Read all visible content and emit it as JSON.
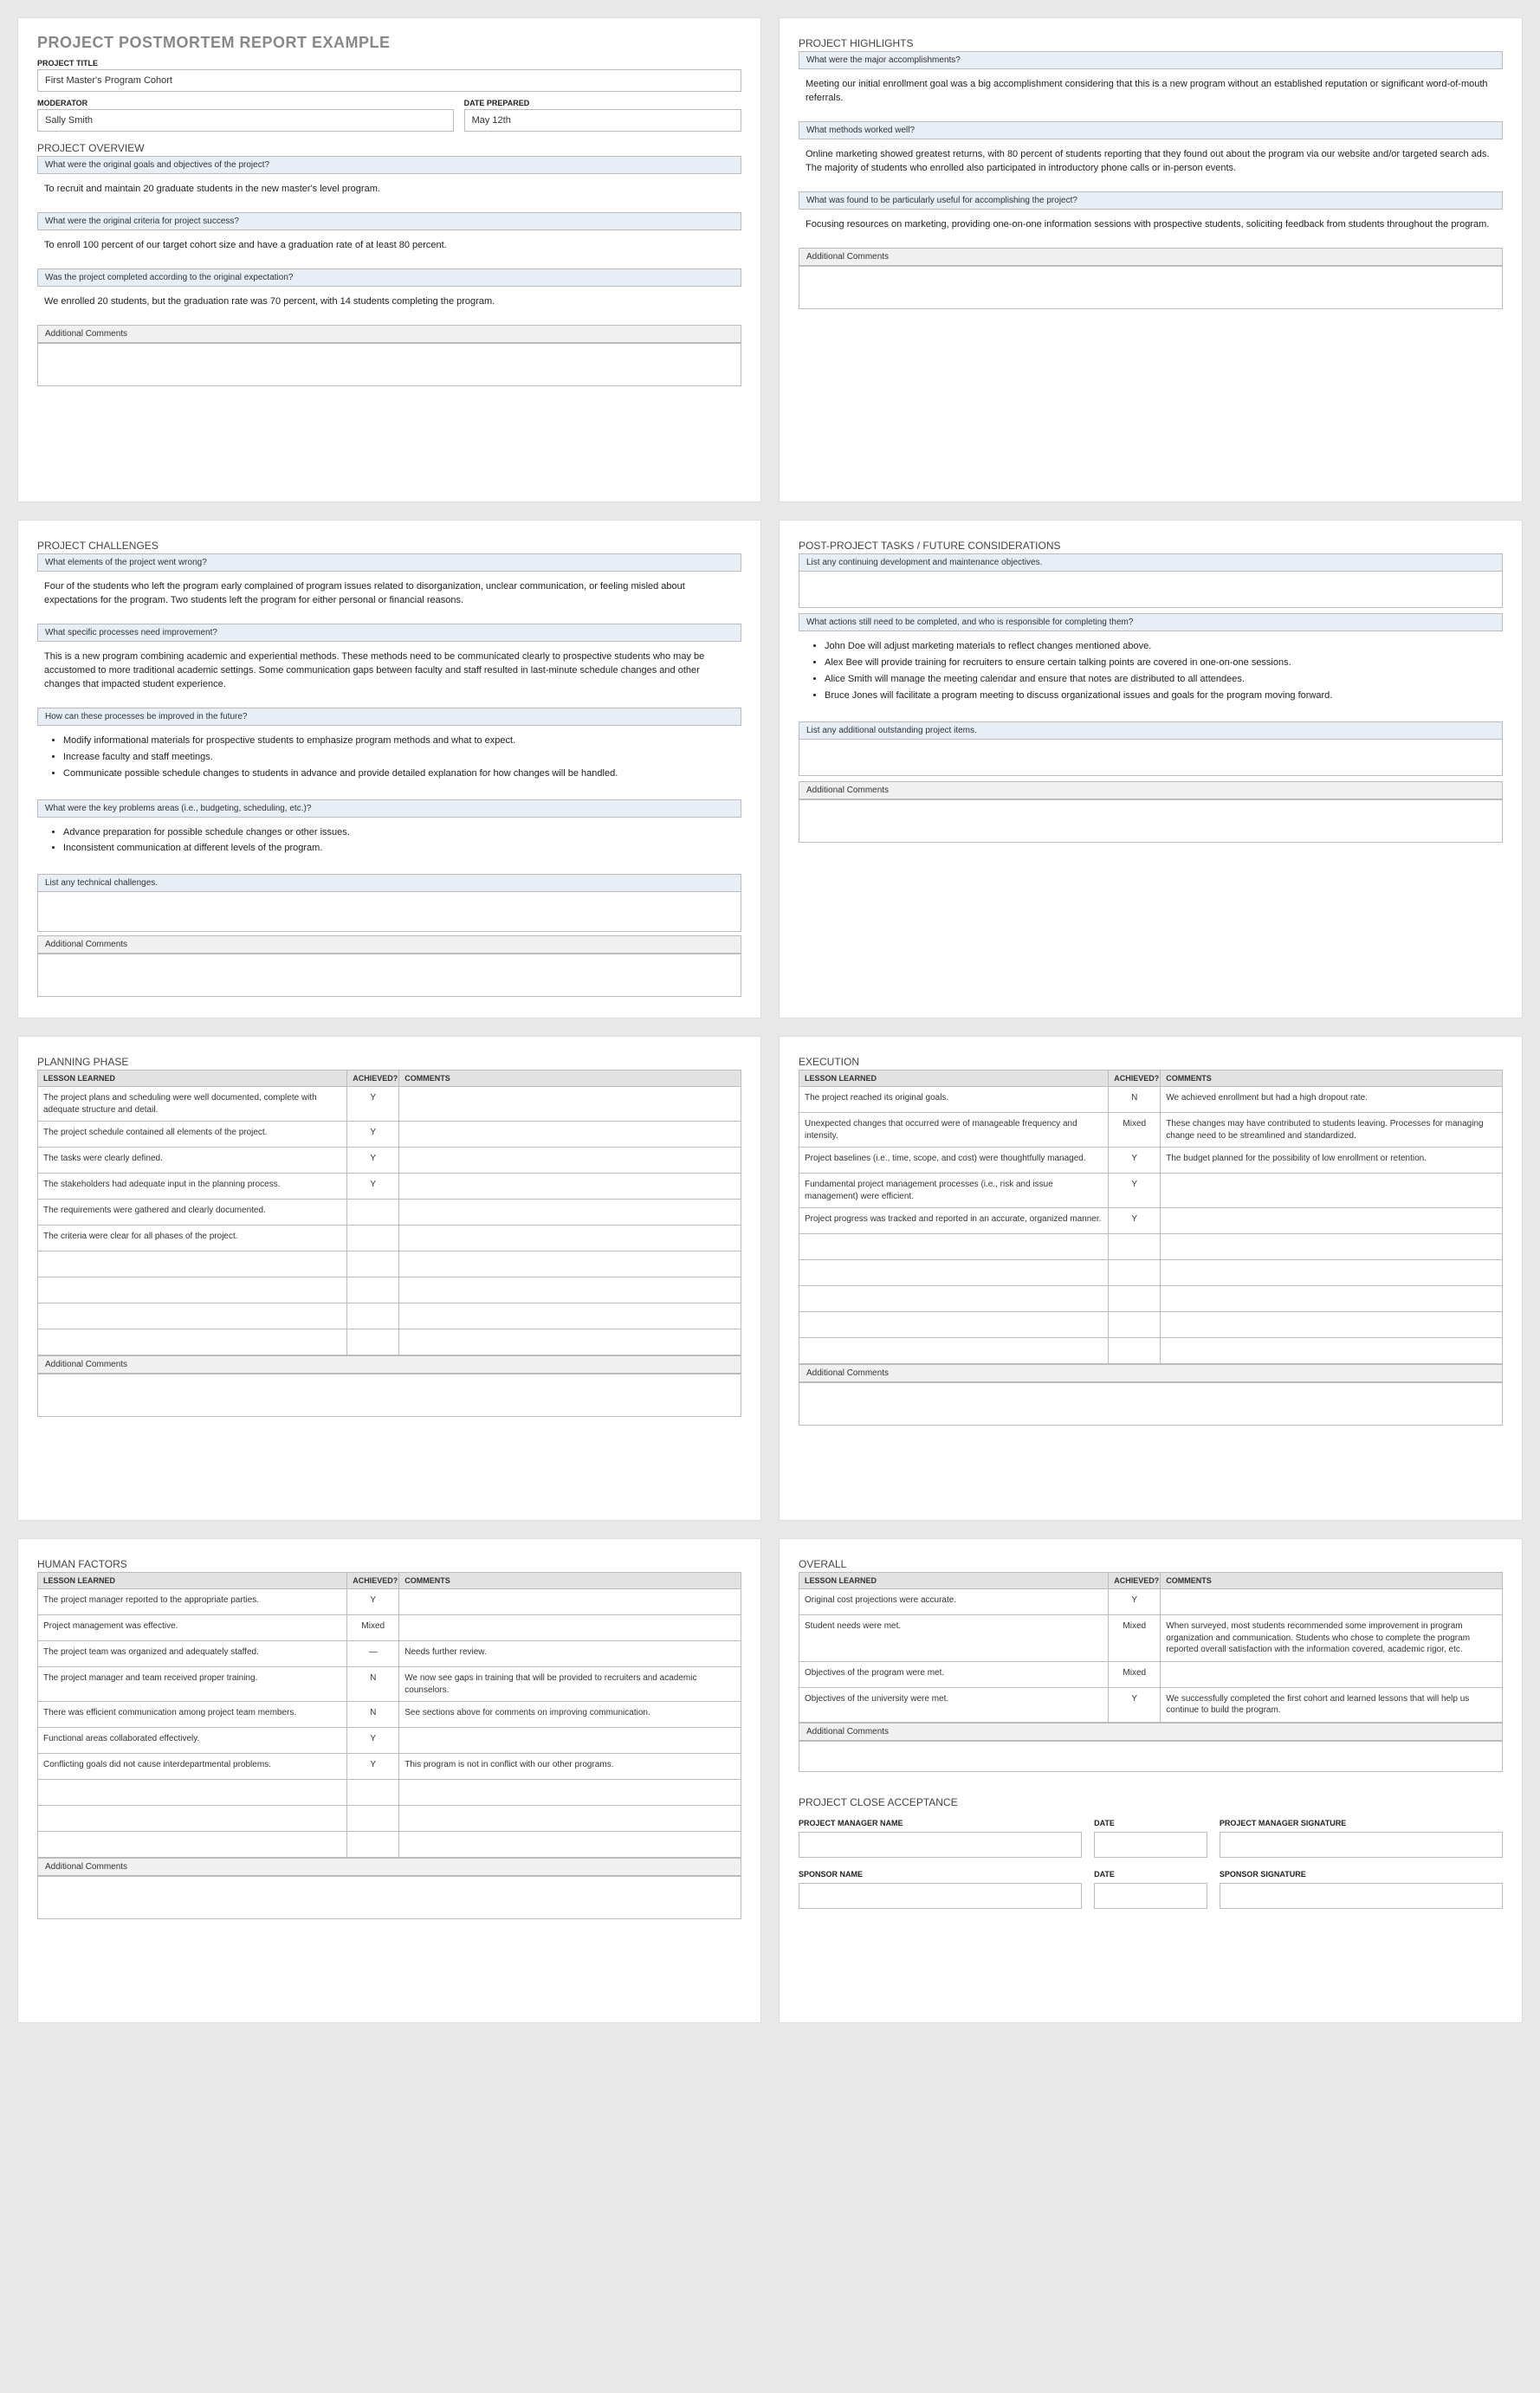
{
  "docTitle": "PROJECT POSTMORTEM REPORT EXAMPLE",
  "labels": {
    "projectTitle": "PROJECT TITLE",
    "moderator": "MODERATOR",
    "datePrepared": "DATE PREPARED",
    "additionalComments": "Additional Comments",
    "lessonLearned": "LESSON LEARNED",
    "achieved": "ACHIEVED?",
    "comments": "COMMENTS"
  },
  "header": {
    "projectTitle": "First Master's Program Cohort",
    "moderator": "Sally Smith",
    "datePrepared": "May 12th"
  },
  "sections": {
    "overview": {
      "title": "PROJECT OVERVIEW",
      "items": [
        {
          "q": "What were the original goals and objectives of the project?",
          "a": "To recruit and maintain 20 graduate students in the new master's level program."
        },
        {
          "q": "What were the original criteria for project success?",
          "a": "To enroll 100 percent of our target cohort size and have a graduation rate of at least 80 percent."
        },
        {
          "q": "Was the project completed according to the original expectation?",
          "a": "We enrolled 20 students, but the graduation rate was 70 percent, with 14 students completing the program."
        }
      ]
    },
    "highlights": {
      "title": "PROJECT HIGHLIGHTS",
      "items": [
        {
          "q": "What were the major accomplishments?",
          "a": "Meeting our initial enrollment goal was a big accomplishment considering that this is a new program without an established reputation or significant word-of-mouth referrals."
        },
        {
          "q": "What methods worked well?",
          "a": "Online marketing showed greatest returns, with 80 percent of students reporting that they found out about the program via our website and/or targeted search ads. The majority of students who enrolled also participated in introductory phone calls or in-person events."
        },
        {
          "q": "What was found to be particularly useful for accomplishing the project?",
          "a": "Focusing resources on marketing, providing one-on-one information sessions with prospective students, soliciting feedback from students throughout the program."
        }
      ]
    },
    "challenges": {
      "title": "PROJECT CHALLENGES",
      "items": [
        {
          "q": "What elements of the project went wrong?",
          "a": "Four of the students who left the program early complained of program issues related to disorganization, unclear communication, or feeling misled  about expectations for the program. Two students left the program for either personal or financial reasons."
        },
        {
          "q": "What specific processes need improvement?",
          "a": "This is a new program combining academic and experiential methods. These methods need to be communicated clearly to prospective students who may be accustomed to more traditional academic settings. Some communication gaps between faculty and staff resulted in last-minute schedule changes and other changes that impacted student experience."
        },
        {
          "q": "How can these processes be improved in the future?",
          "list": [
            "Modify informational materials for prospective students to emphasize program methods and what to expect.",
            "Increase faculty and staff meetings.",
            "Communicate possible schedule changes to students in advance and provide detailed explanation for how changes will be handled."
          ]
        },
        {
          "q": "What were the key problems areas (i.e., budgeting, scheduling, etc.)?",
          "list": [
            "Advance preparation for possible schedule changes or other issues.",
            "Inconsistent communication at different levels of the program."
          ]
        },
        {
          "q": "List any technical challenges.",
          "a": ""
        }
      ]
    },
    "postTasks": {
      "title": "POST-PROJECT TASKS / FUTURE CONSIDERATIONS",
      "items": [
        {
          "q": "List any continuing development and maintenance objectives.",
          "a": "",
          "boxed": true
        },
        {
          "q": "What actions still need to be completed, and who is responsible for completing them?",
          "list": [
            "John Doe will adjust marketing materials to reflect changes mentioned above.",
            "Alex Bee will provide training for recruiters to ensure certain talking points are covered in one-on-one sessions.",
            "Alice Smith will manage the meeting calendar and ensure that notes are distributed to all attendees.",
            "Bruce Jones will facilitate a program meeting to discuss organizational issues and goals for the program moving forward."
          ]
        },
        {
          "q": "List any additional outstanding project items.",
          "a": "",
          "boxed": true
        }
      ]
    }
  },
  "lessonTables": {
    "planning": {
      "title": "PLANNING PHASE",
      "rows": [
        {
          "l": "The project plans and scheduling were well documented, complete with adequate structure and detail.",
          "ach": "Y",
          "c": ""
        },
        {
          "l": "The project schedule contained all elements of the project.",
          "ach": "Y",
          "c": ""
        },
        {
          "l": "The tasks were clearly defined.",
          "ach": "Y",
          "c": ""
        },
        {
          "l": "The stakeholders had adequate input in the planning process.",
          "ach": "Y",
          "c": ""
        },
        {
          "l": "The requirements were gathered and clearly documented.",
          "ach": "",
          "c": ""
        },
        {
          "l": "The criteria were clear for all phases of the project.",
          "ach": "",
          "c": ""
        }
      ],
      "blankRows": 4
    },
    "execution": {
      "title": "EXECUTION",
      "rows": [
        {
          "l": "The project reached its original goals.",
          "ach": "N",
          "c": "We achieved enrollment but had a high dropout rate."
        },
        {
          "l": "Unexpected changes that occurred were of manageable frequency and intensity.",
          "ach": "Mixed",
          "c": "These changes may have contributed to students leaving. Processes for managing change need to be streamlined and standardized."
        },
        {
          "l": "Project baselines (i.e., time, scope, and cost) were thoughtfully managed.",
          "ach": "Y",
          "c": "The budget planned for the possibility of low enrollment or retention."
        },
        {
          "l": "Fundamental project management processes (i.e., risk and issue management) were efficient.",
          "ach": "Y",
          "c": ""
        },
        {
          "l": "Project progress was tracked and reported in an accurate, organized manner.",
          "ach": "Y",
          "c": ""
        }
      ],
      "blankRows": 5
    },
    "human": {
      "title": "HUMAN FACTORS",
      "rows": [
        {
          "l": "The project manager reported to the appropriate parties.",
          "ach": "Y",
          "c": ""
        },
        {
          "l": "Project management was effective.",
          "ach": "Mixed",
          "c": ""
        },
        {
          "l": "The project team was organized and adequately staffed.",
          "ach": "—",
          "c": "Needs further review."
        },
        {
          "l": "The project manager and team received proper training.",
          "ach": "N",
          "c": "We now see gaps in training that will be provided to recruiters and academic counselors."
        },
        {
          "l": "There was efficient communication among project team members.",
          "ach": "N",
          "c": "See sections above for comments on improving communication."
        },
        {
          "l": "Functional areas collaborated effectively.",
          "ach": "Y",
          "c": ""
        },
        {
          "l": "Conflicting goals did not cause interdepartmental problems.",
          "ach": "Y",
          "c": "This program is not in conflict with our other programs."
        }
      ],
      "blankRows": 3
    },
    "overall": {
      "title": "OVERALL",
      "rows": [
        {
          "l": "Original cost projections were accurate.",
          "ach": "Y",
          "c": ""
        },
        {
          "l": "Student needs were met.",
          "ach": "Mixed",
          "c": "When surveyed, most students recommended some improvement in program organization and communication. Students who chose to complete the program reported overall satisfaction with the information covered, academic rigor, etc."
        },
        {
          "l": "Objectives of the program were met.",
          "ach": "Mixed",
          "c": ""
        },
        {
          "l": "Objectives of the university were met.",
          "ach": "Y",
          "c": "We successfully completed the first cohort and learned lessons that will help us continue to build the program."
        }
      ],
      "blankRows": 0
    }
  },
  "closeAcceptance": {
    "title": "PROJECT CLOSE ACCEPTANCE",
    "rows": [
      {
        "name": "PROJECT MANAGER NAME",
        "date": "DATE",
        "sig": "PROJECT MANAGER SIGNATURE"
      },
      {
        "name": "SPONSOR NAME",
        "date": "DATE",
        "sig": "SPONSOR SIGNATURE"
      }
    ]
  }
}
